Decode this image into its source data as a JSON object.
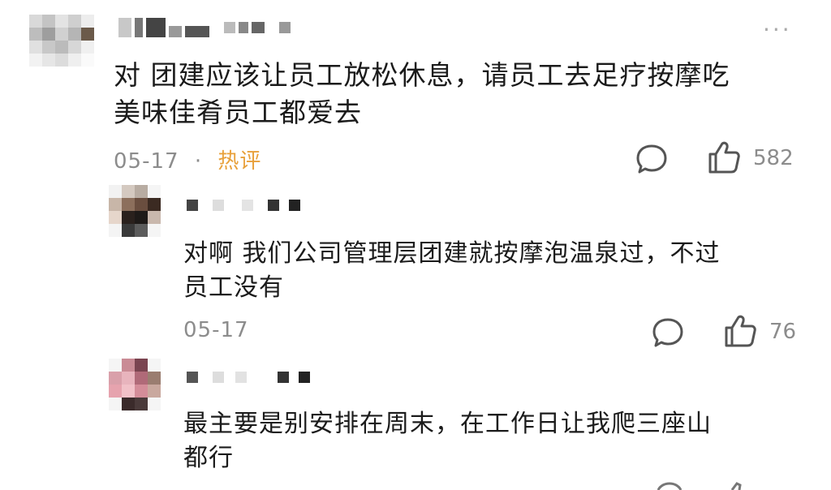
{
  "comment": {
    "text_line1": "对 团建应该让员工放松休息，请员工去足疗按摩吃",
    "text_line2": "美味佳肴员工都爱去",
    "date": "05-17",
    "separator": "·",
    "badge": "热评",
    "likes": "582",
    "icons": [
      "more-icon",
      "reply-bubble-icon",
      "thumbs-up-icon"
    ]
  },
  "replies": [
    {
      "text_line1": "对啊 我们公司管理层团建就按摩泡温泉过，不过",
      "text_line2": "员工没有",
      "date": "05-17",
      "likes": "76"
    },
    {
      "text_line1": "最主要是别安排在周末，在工作日让我爬三座山",
      "text_line2": "都行"
    }
  ],
  "colors": {
    "badge": "#e8a03a",
    "meta": "#8c8c8c",
    "text": "#1b1b1b"
  }
}
